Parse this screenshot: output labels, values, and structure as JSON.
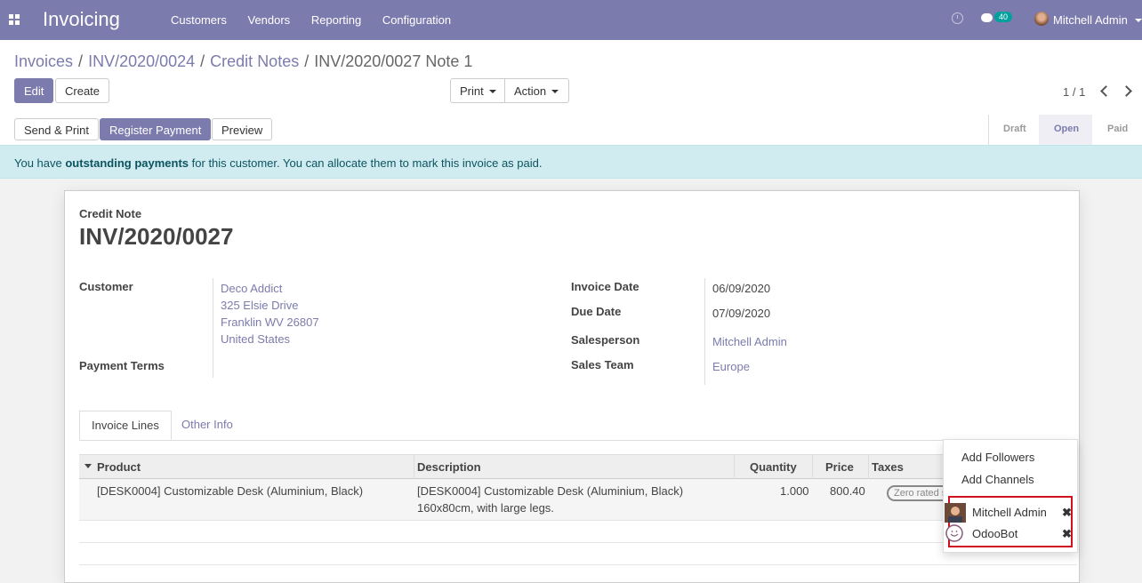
{
  "navbar": {
    "app_title": "Invoicing",
    "menu": [
      "Customers",
      "Vendors",
      "Reporting",
      "Configuration"
    ],
    "messages_count": "40",
    "user_name": "Mitchell Admin"
  },
  "breadcrumb": {
    "items": [
      "Invoices",
      "INV/2020/0024",
      "Credit Notes"
    ],
    "current": "INV/2020/0027 Note 1",
    "separator": "/"
  },
  "buttons": {
    "edit": "Edit",
    "create": "Create",
    "print": "Print",
    "action": "Action",
    "send_print": "Send & Print",
    "register_payment": "Register Payment",
    "preview": "Preview"
  },
  "pager": "1 / 1",
  "statusbar": {
    "stages": [
      "Draft",
      "Open",
      "Paid"
    ],
    "active": "Open"
  },
  "alert": {
    "prefix": "You have ",
    "bold": "outstanding payments",
    "suffix": " for this customer. You can allocate them to mark this invoice as paid."
  },
  "invoice": {
    "doc_type": "Credit Note",
    "number": "INV/2020/0027",
    "customer_label": "Customer",
    "customer": [
      "Deco Addict",
      "325 Elsie Drive",
      "Franklin WV 26807",
      "United States"
    ],
    "payment_terms_label": "Payment Terms",
    "invoice_date_label": "Invoice Date",
    "invoice_date": "06/09/2020",
    "due_date_label": "Due Date",
    "due_date": "07/09/2020",
    "salesperson_label": "Salesperson",
    "salesperson": "Mitchell Admin",
    "sales_team_label": "Sales Team",
    "sales_team": "Europe"
  },
  "tabs": [
    "Invoice Lines",
    "Other Info"
  ],
  "table": {
    "headers": [
      "Product",
      "Description",
      "Quantity",
      "Price",
      "Taxes"
    ],
    "rows": [
      {
        "product": "[DESK0004] Customizable Desk (Aluminium, Black)",
        "description_1": "[DESK0004] Customizable Desk (Aluminium, Black)",
        "description_2": "160x80cm, with large legs.",
        "quantity": "1.000",
        "price": "800.40",
        "taxes": "Zero rated sal"
      }
    ]
  },
  "followers_dropdown": {
    "add_followers": "Add Followers",
    "add_channels": "Add Channels",
    "followers": [
      "Mitchell Admin",
      "OdooBot"
    ],
    "remove_glyph": "✖"
  },
  "colors": {
    "brand": "#7c7bad",
    "alert_bg": "#d1ecf1",
    "highlight": "#d01020"
  }
}
